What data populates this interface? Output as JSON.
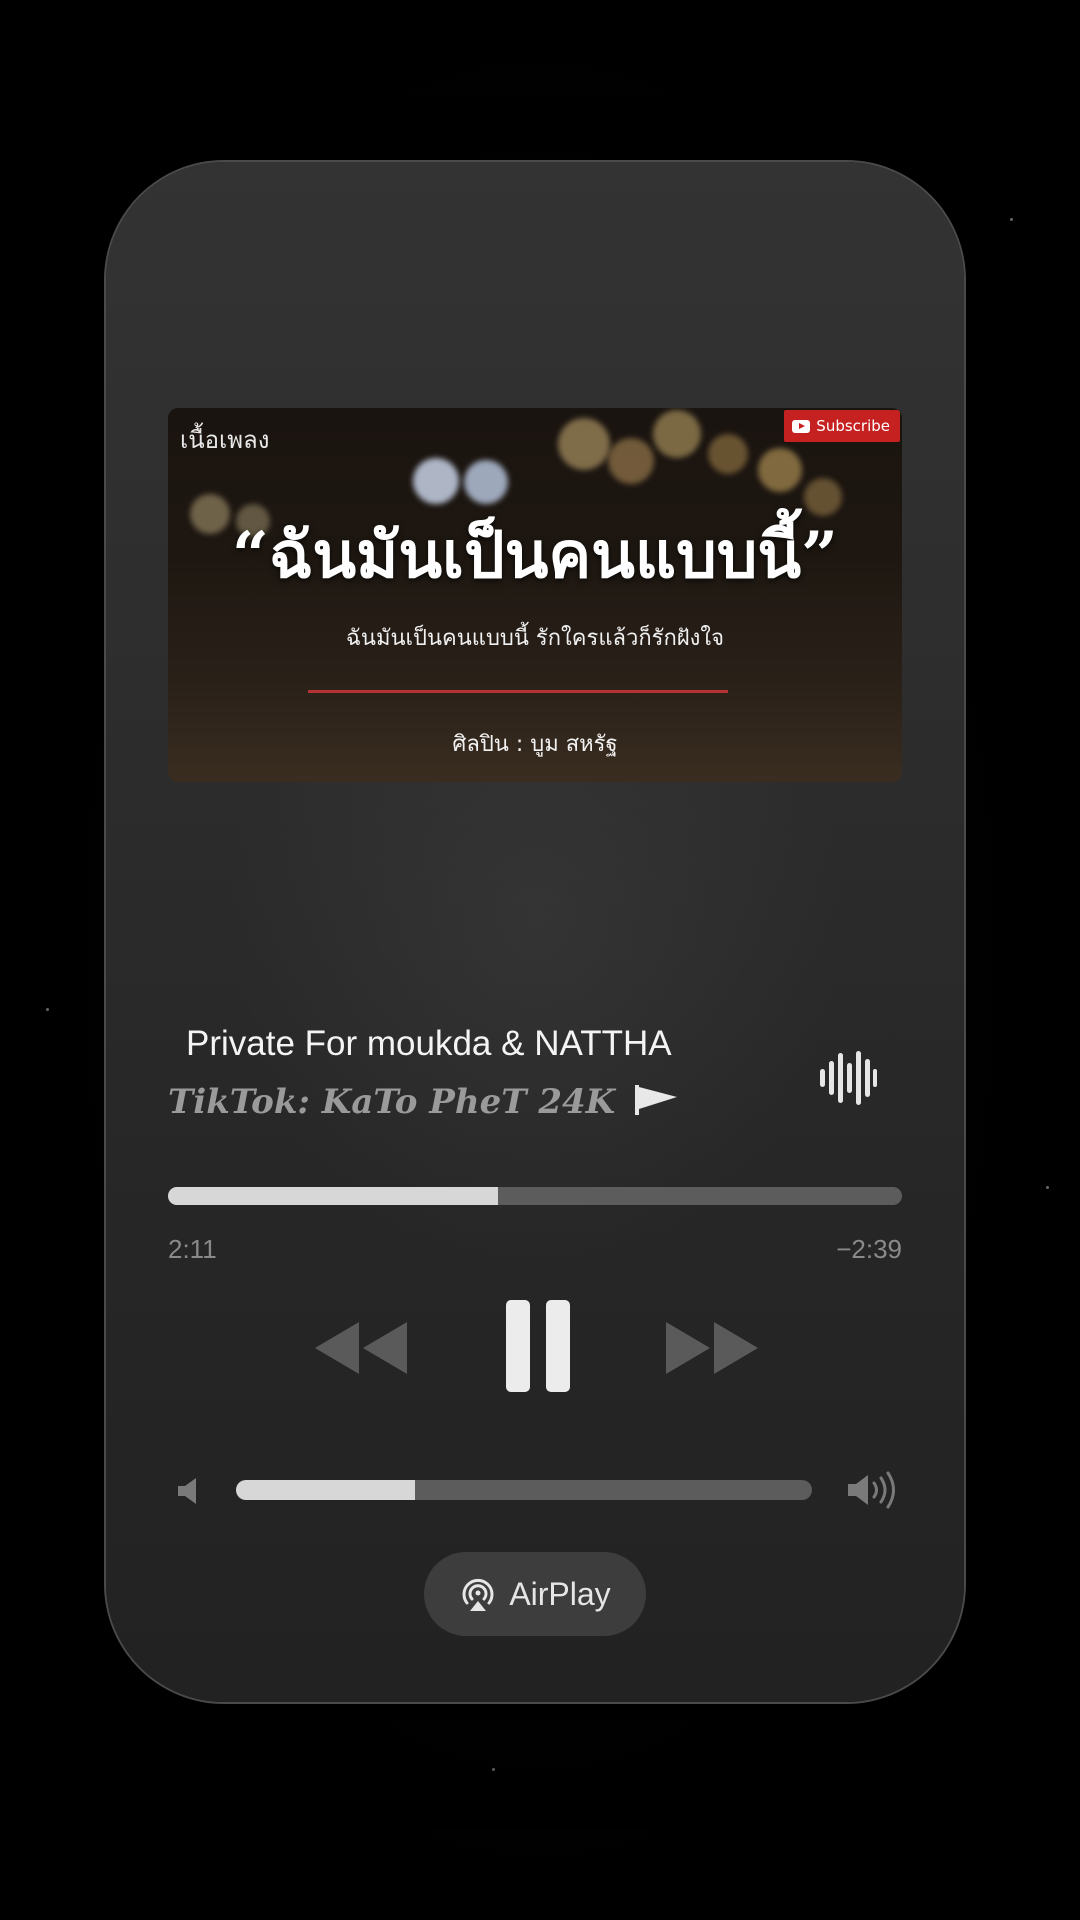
{
  "artwork": {
    "top_left_label": "เนื้อเพลง",
    "subscribe_label": "Subscribe",
    "title": "“ฉันมันเป็นคนแบบนี้”",
    "subtitle": "ฉันมันเป็นคนแบบนี้ รักใครแล้วก็รักฝังใจ",
    "artist_line": "ศิลปิน : บูม สหรัฐ"
  },
  "track": {
    "title": "Private For moukda & NATTHA",
    "artist": "TikTok: KaTo PheT 24K"
  },
  "playback": {
    "elapsed": "2:11",
    "remaining": "−2:39",
    "progress_fraction": 0.45,
    "volume_fraction": 0.31,
    "state": "playing"
  },
  "airplay": {
    "label": "AirPlay"
  },
  "icons": {
    "waveform": "waveform-icon",
    "rewind": "rewind-icon",
    "pause": "pause-icon",
    "forward": "fast-forward-icon",
    "volume_low": "speaker-low-icon",
    "volume_high": "speaker-high-icon",
    "airplay": "airplay-icon",
    "flag": "flag-icon"
  },
  "colors": {
    "background": "#000000",
    "card": "#2c2c2c",
    "progress_fill": "#d7d7d7",
    "progress_track": "#5c5c5c",
    "subscribe_badge": "#c62121"
  }
}
